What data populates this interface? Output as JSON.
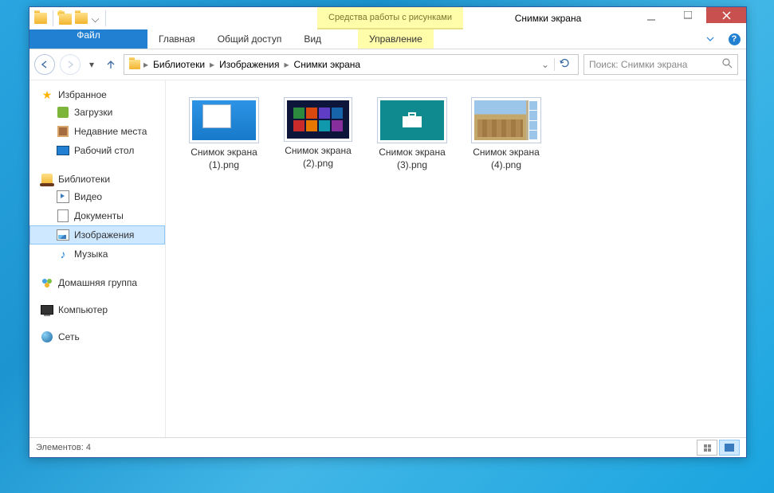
{
  "window": {
    "context_tab_title": "Средства работы с рисунками",
    "title": "Снимки экрана"
  },
  "ribbon": {
    "file": "Файл",
    "home": "Главная",
    "share": "Общий доступ",
    "view": "Вид",
    "manage": "Управление"
  },
  "breadcrumbs": {
    "c1": "Библиотеки",
    "c2": "Изображения",
    "c3": "Снимки экрана"
  },
  "search": {
    "placeholder": "Поиск: Снимки экрана"
  },
  "sidebar": {
    "favorites": "Избранное",
    "downloads": "Загрузки",
    "recent": "Недавние места",
    "desktop": "Рабочий стол",
    "libraries": "Библиотеки",
    "video": "Видео",
    "documents": "Документы",
    "pictures": "Изображения",
    "music": "Музыка",
    "homegroup": "Домашняя группа",
    "computer": "Компьютер",
    "network": "Сеть"
  },
  "files": [
    {
      "name": "Снимок экрана (1).png"
    },
    {
      "name": "Снимок экрана (2).png"
    },
    {
      "name": "Снимок экрана (3).png"
    },
    {
      "name": "Снимок экрана (4).png"
    }
  ],
  "status": {
    "count_label": "Элементов: 4"
  }
}
